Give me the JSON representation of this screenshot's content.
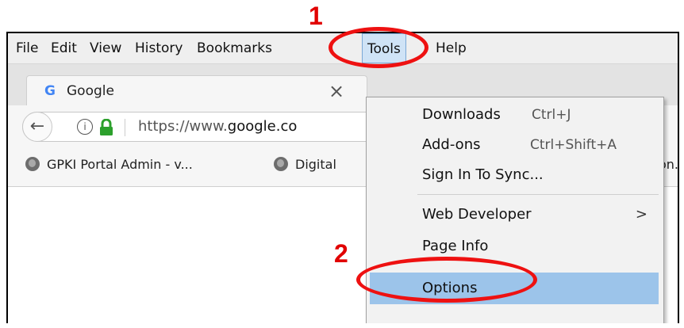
{
  "menubar": {
    "items": [
      {
        "label": "File"
      },
      {
        "label": "Edit"
      },
      {
        "label": "View"
      },
      {
        "label": "History"
      },
      {
        "label": "Bookmarks"
      },
      {
        "label": "Tools"
      },
      {
        "label": "Help"
      }
    ]
  },
  "tab": {
    "favicon": "G",
    "title": "Google",
    "close": "×"
  },
  "navbar": {
    "url_prefix": "https://www.",
    "url_domain": "google.co",
    "back": "←",
    "info": "i"
  },
  "bookmarks": {
    "items": [
      {
        "label": "GPKI Portal Admin - v..."
      },
      {
        "label": "Digital"
      },
      {
        "label": "on..."
      }
    ]
  },
  "tools_menu": {
    "items": [
      {
        "label": "Downloads",
        "shortcut": "Ctrl+J"
      },
      {
        "label": "Add-ons",
        "shortcut": "Ctrl+Shift+A"
      },
      {
        "label": "Sign In To Sync..."
      },
      {
        "label": "Web Developer",
        "submenu": ">"
      },
      {
        "label": "Page Info"
      },
      {
        "label": "Options"
      }
    ]
  },
  "annotations": {
    "step1": "1",
    "step2": "2"
  },
  "colors": {
    "highlight": "#9cc4ea",
    "annotation": "#e10000",
    "lock": "#2ca02c"
  }
}
